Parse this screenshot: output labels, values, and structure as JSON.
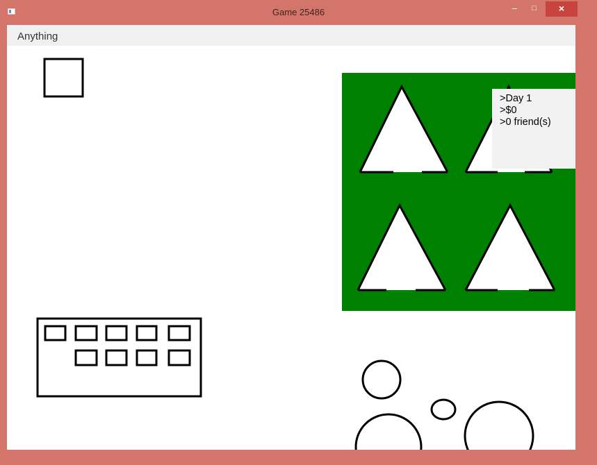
{
  "window": {
    "title": "Game 25486",
    "minimize_glyph": "–",
    "maximize_glyph": "□",
    "close_glyph": "×"
  },
  "menu": {
    "items": [
      "Anything"
    ]
  },
  "hud": {
    "day": ">Day 1",
    "money": ">$0",
    "friends": ">0 friend(s)"
  },
  "colors": {
    "frame": "#d4756b",
    "field": "#008000",
    "stats_panel": "#f2f2f2",
    "outline": "#000000"
  },
  "icons": {
    "tree": "white-triangle",
    "window_cell": "rectangle",
    "bubble": "circle"
  }
}
